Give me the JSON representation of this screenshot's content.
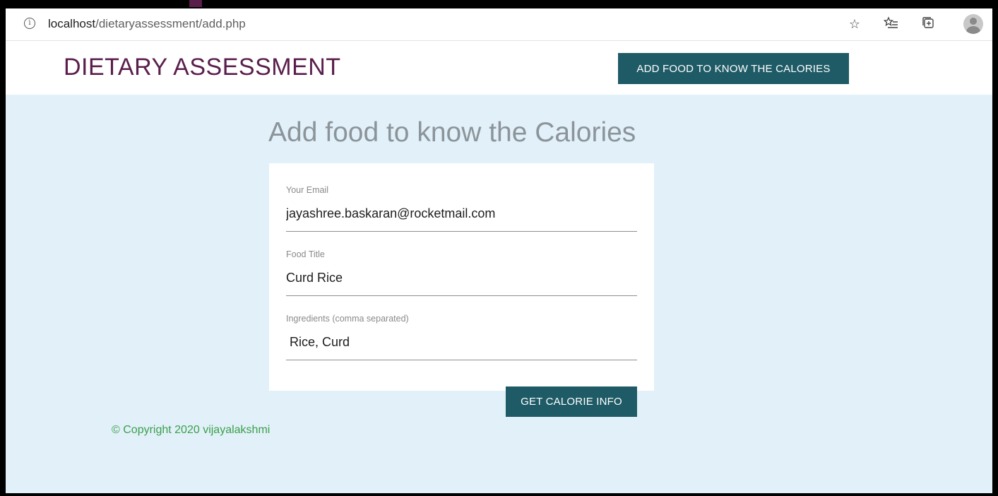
{
  "browser": {
    "url_host": "localhost",
    "url_path": "/dietaryassessment/add.php",
    "icons": [
      "info-icon",
      "star-icon",
      "favorites-icon",
      "collections-icon",
      "profile-avatar"
    ]
  },
  "header": {
    "brand": "DIETARY ASSESSMENT",
    "nav_button": "ADD FOOD TO KNOW THE CALORIES"
  },
  "main": {
    "title": "Add food to know the Calories",
    "form": {
      "email_label": "Your Email",
      "email_value": "jayashree.baskaran@rocketmail.com",
      "food_title_label": "Food Title",
      "food_title_value": "Curd Rice",
      "ingredients_label": "Ingredients (comma separated)",
      "ingredients_value": " Rice, Curd",
      "submit_label": "GET CALORIE INFO"
    }
  },
  "footer": {
    "copyright": "© Copyright 2020 vijayalakshmi"
  },
  "colors": {
    "brand": "#5a1e4c",
    "button": "#1f5b66",
    "background": "#e2f0fa",
    "footer_text": "#3aa04a",
    "title_text": "#8b9499"
  }
}
